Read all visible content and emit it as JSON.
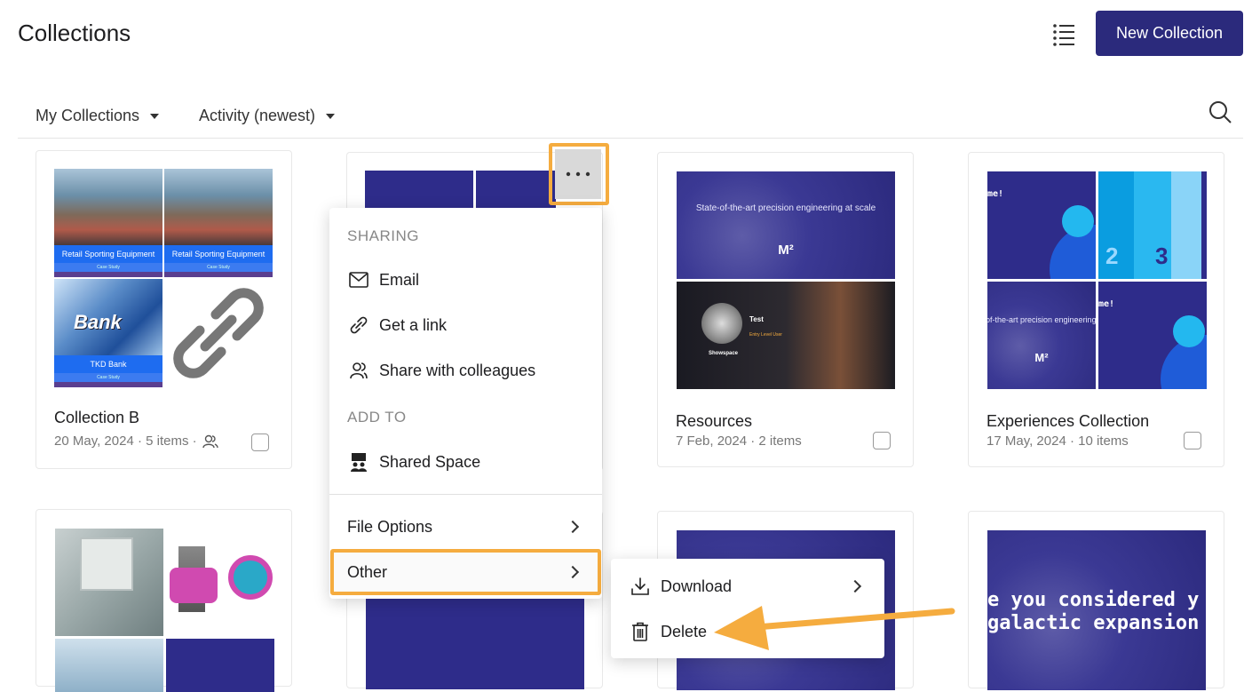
{
  "header": {
    "title": "Collections",
    "new_button": "New Collection"
  },
  "filters": {
    "owner": "My Collections",
    "sort": "Activity (newest)"
  },
  "cards": [
    {
      "title": "Collection B",
      "meta": "20 May, 2024 · 5 items ·",
      "tiles": [
        {
          "band": "Retail Sporting Equipment",
          "sub": "Case Study"
        },
        {
          "band": "Retail Sporting Equipment",
          "sub": "Case Study"
        },
        {
          "band": "TKD Bank",
          "sub": "Case Study",
          "photo_text": "Bank"
        }
      ]
    },
    {
      "title": "Resources",
      "meta": "7 Feb, 2024 · 2 items",
      "slide1_text": "State-of-the-art precision engineering at scale",
      "slide1_logo": "M²",
      "slide2": {
        "name": "Test",
        "role": "Entry Level User",
        "brand": "Showspace"
      }
    },
    {
      "title": "Experiences Collection",
      "meta": "17 May, 2024 · 10 items",
      "tile_texts": {
        "a": "me!",
        "b": "2",
        "c": "3",
        "d": "of-the-art precision engineering",
        "e": "M²",
        "f": "me!"
      }
    },
    {
      "slide_text_line1": "e you considered y",
      "slide_text_line2": "galactic expansion"
    }
  ],
  "menu": {
    "sharing_label": "SHARING",
    "email": "Email",
    "get_link": "Get a link",
    "share_colleagues": "Share with colleagues",
    "add_to_label": "ADD TO",
    "shared_space": "Shared Space",
    "file_options": "File Options",
    "other": "Other"
  },
  "submenu": {
    "download": "Download",
    "delete": "Delete"
  },
  "colors": {
    "accent": "#2b2a7c",
    "highlight": "#f5ac3f",
    "slide": "#2e2c8a"
  }
}
